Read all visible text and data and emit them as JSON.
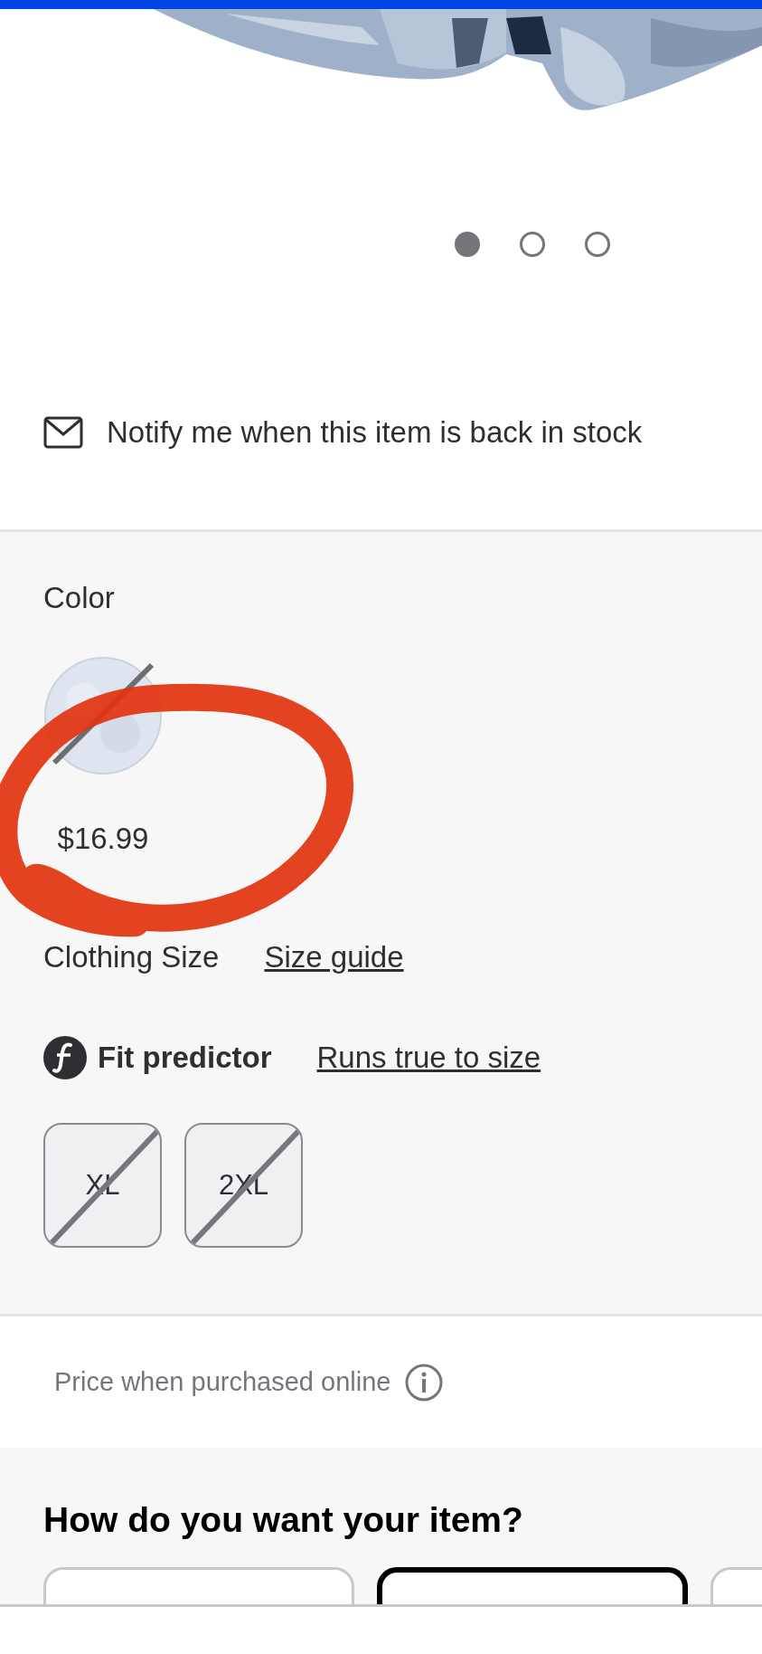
{
  "gallery": {
    "dots": [
      {
        "selected": true
      },
      {
        "selected": false
      },
      {
        "selected": false
      }
    ]
  },
  "notify": {
    "label": "Notify me when this item is back in stock"
  },
  "color_section": {
    "label": "Color",
    "swatches": [
      {
        "available": false,
        "price": "$16.99"
      }
    ]
  },
  "size_section": {
    "label": "Clothing Size",
    "guide_link": "Size guide",
    "fit_label": "Fit predictor",
    "fit_link": "Runs true to size",
    "sizes": [
      {
        "label": "XL",
        "disabled": true
      },
      {
        "label": "2XL",
        "disabled": true
      }
    ]
  },
  "price_note": {
    "label": "Price when purchased online"
  },
  "fulfillment": {
    "title": "How do you want your item?",
    "options": [
      {
        "selected": false
      },
      {
        "selected": true
      },
      {
        "selected": false
      }
    ]
  },
  "markup": {
    "kind": "circle"
  }
}
